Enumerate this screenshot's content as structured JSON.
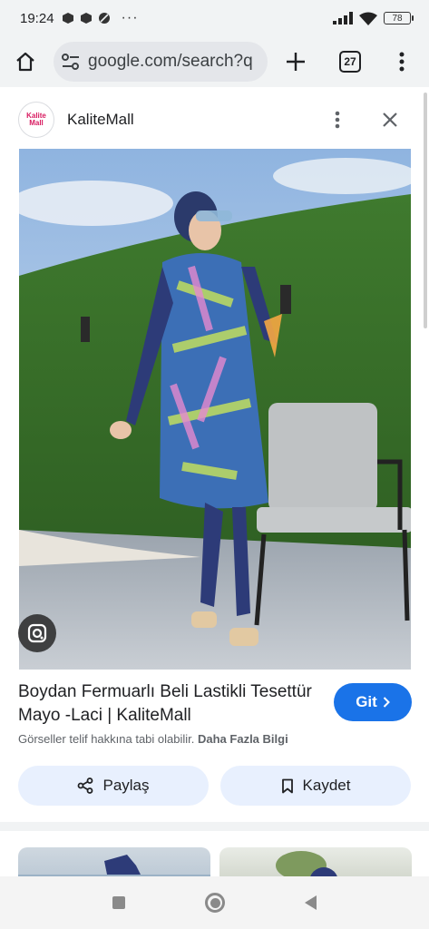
{
  "status_bar": {
    "time": "19:24",
    "battery": "78"
  },
  "browser": {
    "url": "google.com/search?q",
    "tab_count": "27"
  },
  "site": {
    "logo_text": "Kalite Mall",
    "name": "KaliteMall"
  },
  "product": {
    "title": "Boydan Fermuarlı Beli Lastikli Tesettür Mayo -Laci | KaliteMall",
    "go_label": "Git",
    "copyright_text": "Görseller telif hakkına tabi olabilir.",
    "more_info_label": "Daha Fazla Bilgi"
  },
  "actions": {
    "share_label": "Paylaş",
    "save_label": "Kaydet"
  },
  "colors": {
    "accent": "#1a73e8",
    "action_bg": "#e8f0fe"
  }
}
